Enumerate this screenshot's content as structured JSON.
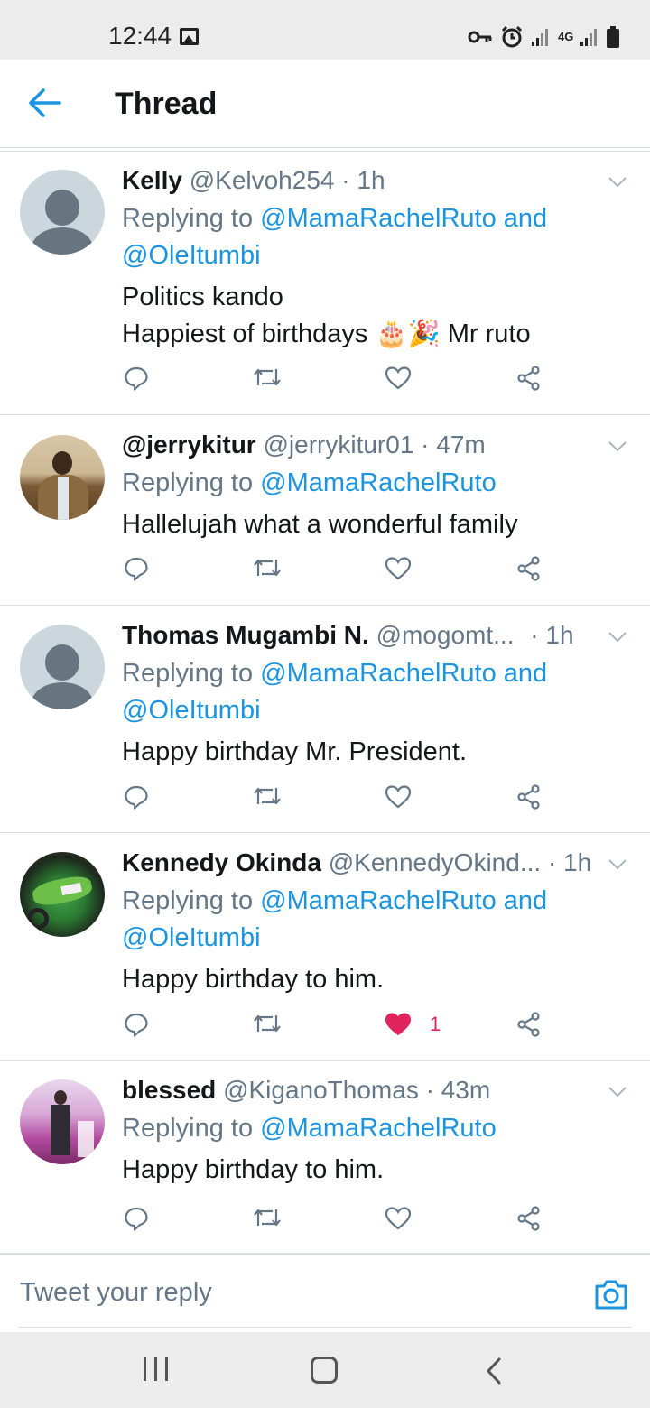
{
  "status_bar": {
    "time": "12:44",
    "network_label": "4G"
  },
  "header": {
    "title": "Thread"
  },
  "colors": {
    "accent": "#1b95e0",
    "text": "#14171a",
    "secondary": "#657786",
    "like": "#e0245e",
    "divider": "#d9dde0"
  },
  "tweets": [
    {
      "name": "Kelly",
      "handle": "@Kelvoh254",
      "time": "· 1h",
      "replying_prefix": "Replying to ",
      "replying_line1": "@MamaRachelRuto and",
      "replying_line2": "@OleItumbi",
      "body": "Politics kando\nHappiest of birthdays 🎂🎉 Mr ruto",
      "liked": false,
      "like_count": ""
    },
    {
      "name": "@jerrykitur",
      "handle": "@jerrykitur01",
      "time": "· 47m",
      "replying_prefix": "Replying to ",
      "replying_line1": "@MamaRachelRuto",
      "replying_line2": "",
      "body": "Hallelujah what a wonderful family",
      "liked": false,
      "like_count": ""
    },
    {
      "name": "Thomas Mugambi N.",
      "handle": "@mogomt...",
      "time": "· 1h",
      "replying_prefix": "Replying to ",
      "replying_line1": "@MamaRachelRuto and",
      "replying_line2": "@OleItumbi",
      "body": "Happy birthday Mr. President.",
      "liked": false,
      "like_count": ""
    },
    {
      "name": "Kennedy Okinda",
      "handle": "@KennedyOkind...",
      "time": "· 1h",
      "replying_prefix": "Replying to ",
      "replying_line1": "@MamaRachelRuto and",
      "replying_line2": "@OleItumbi",
      "body": "Happy birthday to him.",
      "liked": true,
      "like_count": "1"
    },
    {
      "name": "blessed",
      "handle": "@KiganoThomas",
      "time": "· 43m",
      "replying_prefix": "Replying to ",
      "replying_line1": "@MamaRachelRuto",
      "replying_line2": "",
      "body": "Happy birthday to him.",
      "liked": false,
      "like_count": ""
    }
  ],
  "reply_box": {
    "placeholder": "Tweet your reply"
  },
  "icons": {
    "back": "arrow-left-icon",
    "reply": "comment-icon",
    "retweet": "retweet-icon",
    "like": "heart-icon",
    "share": "share-icon",
    "caret": "chevron-down-icon",
    "camera": "camera-icon"
  }
}
